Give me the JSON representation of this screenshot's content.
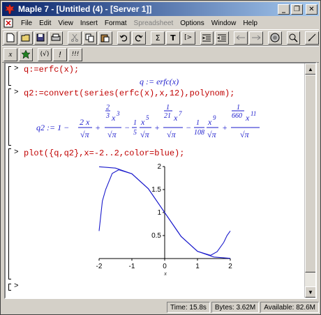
{
  "window": {
    "title": "Maple 7  - [Untitled (4) - [Server 1]]",
    "buttons": {
      "minimize": "_",
      "restore": "❐",
      "close": "✕"
    }
  },
  "menu": [
    "File",
    "Edit",
    "View",
    "Insert",
    "Format",
    "Spreadsheet",
    "Options",
    "Window",
    "Help"
  ],
  "toolbar2": {
    "sigma": "Σ",
    "text_t": "T",
    "arrow_box": "[>"
  },
  "toolbar3": {
    "x_label": "x",
    "parens": "(√)",
    "bang": "!",
    "triple_bang": "!!!"
  },
  "worksheet": {
    "prompt": ">",
    "cmd1": "q:=erfc(x);",
    "out1": "q := erfc(x)",
    "cmd2": "q2:=convert(series(erfc(x),x,12),polynom);",
    "out2": {
      "lhs": "q2 := 1 −",
      "t1_num": "2 x",
      "t1_den": "√π",
      "t2_coef": "2",
      "t2_coef_den": "3",
      "t2_x": "x",
      "t2_exp": "3",
      "t2_den": "√π",
      "t3_sign": "−",
      "t3_coef_num": "1",
      "t3_coef_den": "5",
      "t3_num": "x",
      "t3_exp": "5",
      "t3_den": "√π",
      "t4_coef_num": "1",
      "t4_coef_den": "21",
      "t4_x": "x",
      "t4_exp": "7",
      "t4_den": "√π",
      "t5_sign": "−",
      "t5_coef_num": "1",
      "t5_coef_den": "108",
      "t5_num": "x",
      "t5_exp": "9",
      "t5_den": "√π",
      "t6_coef_num": "1",
      "t6_coef_den": "660",
      "t6_x": "x",
      "t6_exp": "11",
      "t6_den": "√π",
      "plus": "+"
    },
    "cmd3": "plot({q,q2},x=-2..2,color=blue);"
  },
  "chart_data": {
    "type": "line",
    "xlabel": "x",
    "xlim": [
      -2,
      2
    ],
    "ylim": [
      0,
      2
    ],
    "x_ticks": [
      "-2",
      "-1",
      "0",
      "1",
      "2"
    ],
    "y_ticks": [
      "0.5",
      "1",
      "1.5",
      "2"
    ],
    "line_color": "#1a1acc",
    "series": [
      {
        "x": [
          -2,
          -1.5,
          -1,
          -0.5,
          0,
          0.5,
          1,
          1.5,
          2
        ],
        "y": [
          1.995,
          1.966,
          1.843,
          1.52,
          1.0,
          0.48,
          0.157,
          0.034,
          0.005
        ]
      },
      {
        "x": [
          -2,
          -1.9,
          -1.8,
          -1.6,
          -1.4,
          -1.0,
          -0.5,
          0,
          0.5,
          1.0,
          1.4,
          1.6,
          1.8,
          1.9,
          2
        ],
        "y": [
          0.6,
          1.25,
          1.5,
          1.85,
          1.93,
          1.843,
          1.52,
          1.0,
          0.48,
          0.157,
          0.07,
          0.15,
          0.35,
          0.5,
          0.6
        ]
      }
    ]
  },
  "status": {
    "time": "Time: 15.8s",
    "bytes": "Bytes: 3.62M",
    "available": "Available: 82.6M"
  }
}
